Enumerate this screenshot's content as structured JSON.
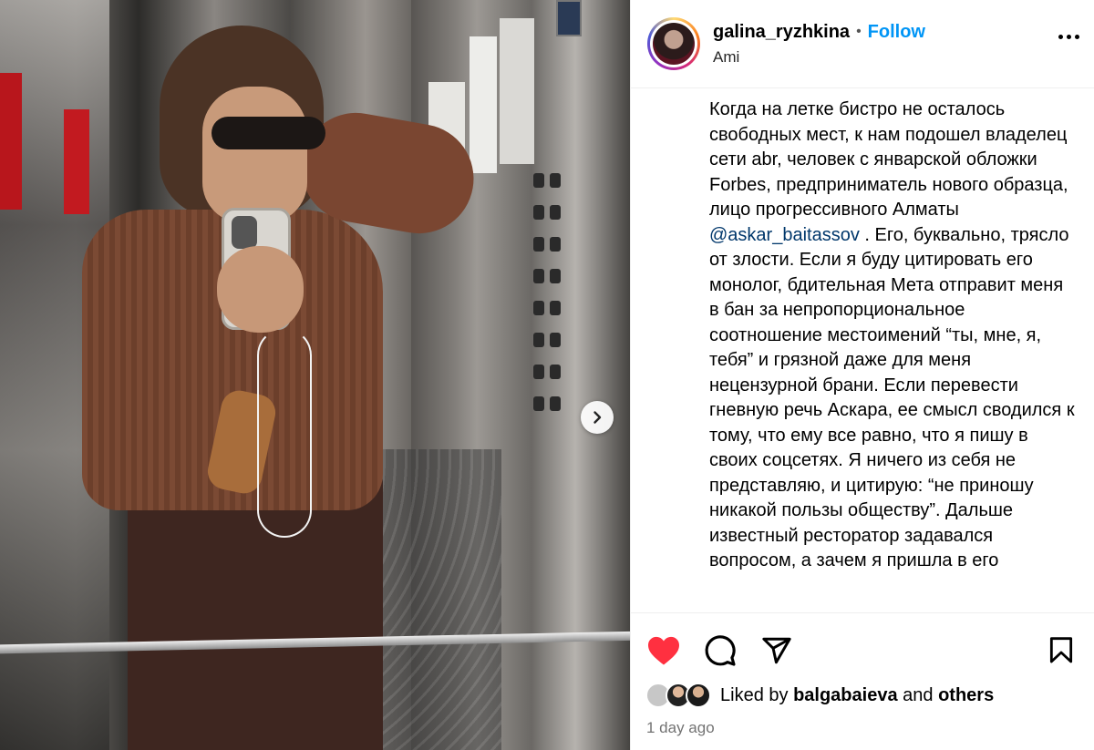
{
  "post": {
    "username": "galina_ryzhkina",
    "separator": "•",
    "follow_label": "Follow",
    "location": "Ami",
    "caption_before_mention": "Когда на летке бистро не осталось свободных мест, к нам подошел владелец сети abr, человек с январской обложки Forbes, предприниматель нового образца, лицо прогрессивного Алматы",
    "mention": "@askar_baitassov",
    "caption_after_mention": " . Его, буквально, трясло от злости. Если я буду цитировать его монолог, бдительная Мета отправит меня в бан за непропорциональное соотношение местоимений “ты, мне, я, тебя” и грязной даже для меня нецензурной брани. Если перевести гневную речь Аскара, ее смысл сводился к тому, что ему все равно, что я пишу в своих соцсетях. Я ничего из себя не представляю, и цитирую: “не приношу никакой пользы обществу”. Дальше известный ресторатор задавался вопросом, а зачем я пришла в его",
    "likes_prefix": "Liked by ",
    "liked_by_user": "balgabaieva",
    "likes_and": " and ",
    "likes_others": "others",
    "time_ago": "1 day ago"
  },
  "icons": {
    "like": "heart-filled-icon",
    "comment": "comment-bubble-icon",
    "share": "paper-plane-icon",
    "save": "bookmark-icon",
    "more": "more-horizontal-icon",
    "next": "chevron-right-icon"
  },
  "colors": {
    "accent": "#0095f6",
    "like_red": "#ff3040",
    "mention": "#00376b",
    "muted": "#737373"
  }
}
